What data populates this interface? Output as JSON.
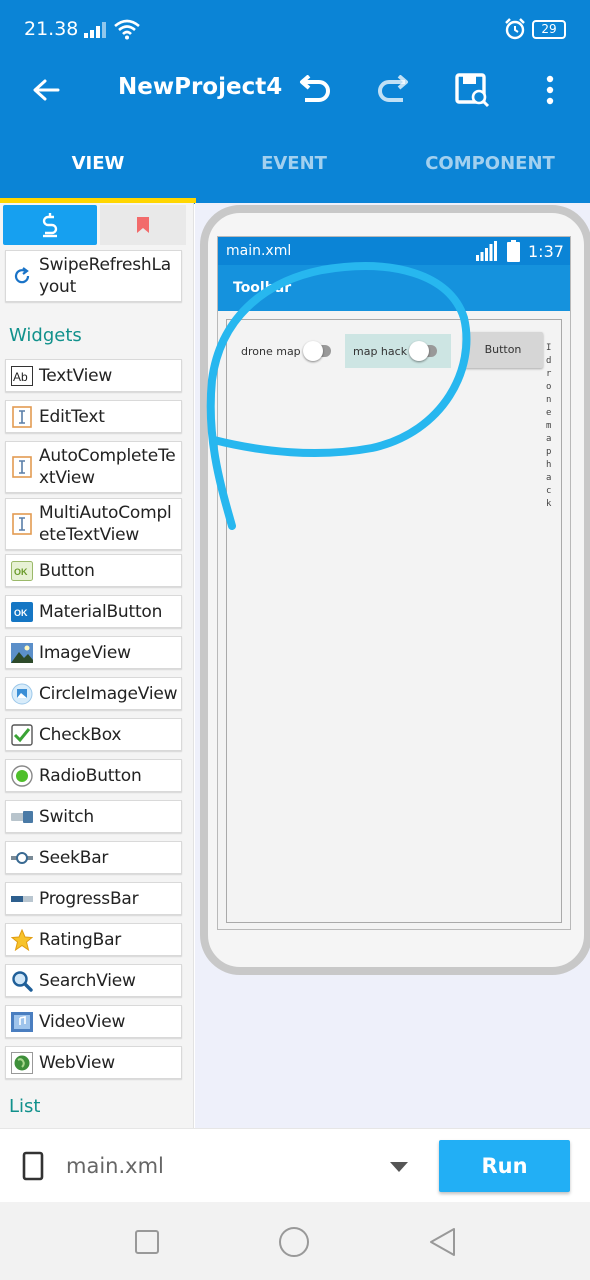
{
  "status_bar": {
    "time": "21.38",
    "battery": "29"
  },
  "toolbar": {
    "title": "NewProject4"
  },
  "tabs": [
    {
      "label": "VIEW"
    },
    {
      "label": "EVENT"
    },
    {
      "label": "COMPONENT"
    }
  ],
  "palette": {
    "top_item": {
      "label": "SwipeRefreshLayout"
    },
    "widgets_header": "Widgets",
    "widgets": [
      {
        "label": "TextView",
        "icon": "textview-icon"
      },
      {
        "label": "EditText",
        "icon": "edittext-icon"
      },
      {
        "label": "AutoCompleteTextView",
        "icon": "autocomplete-icon"
      },
      {
        "label": "MultiAutoCompleteTextView",
        "icon": "multiautocomplete-icon"
      },
      {
        "label": "Button",
        "icon": "button-icon"
      },
      {
        "label": "MaterialButton",
        "icon": "materialbutton-icon"
      },
      {
        "label": "ImageView",
        "icon": "imageview-icon"
      },
      {
        "label": "CircleImageView",
        "icon": "circleimageview-icon"
      },
      {
        "label": "CheckBox",
        "icon": "checkbox-icon"
      },
      {
        "label": "RadioButton",
        "icon": "radiobutton-icon"
      },
      {
        "label": "Switch",
        "icon": "switch-icon"
      },
      {
        "label": "SeekBar",
        "icon": "seekbar-icon"
      },
      {
        "label": "ProgressBar",
        "icon": "progressbar-icon"
      },
      {
        "label": "RatingBar",
        "icon": "ratingbar-icon"
      },
      {
        "label": "SearchView",
        "icon": "searchview-icon"
      },
      {
        "label": "VideoView",
        "icon": "videoview-icon"
      },
      {
        "label": "WebView",
        "icon": "webview-icon"
      }
    ],
    "list_header": "List"
  },
  "preview": {
    "file_label": "main.xml",
    "status_time": "1:37",
    "toolbar_label": "Toolbar",
    "switch1": "drone map",
    "switch2": "map hack",
    "button": "Button",
    "vertical_text": "Idrone map hack"
  },
  "bottom": {
    "file": "main.xml",
    "run": "Run"
  },
  "colors": {
    "primary": "#0b84d6",
    "accent": "#ffd600",
    "run": "#22aff5",
    "section": "#11918c",
    "scribble": "#27b7ef"
  }
}
